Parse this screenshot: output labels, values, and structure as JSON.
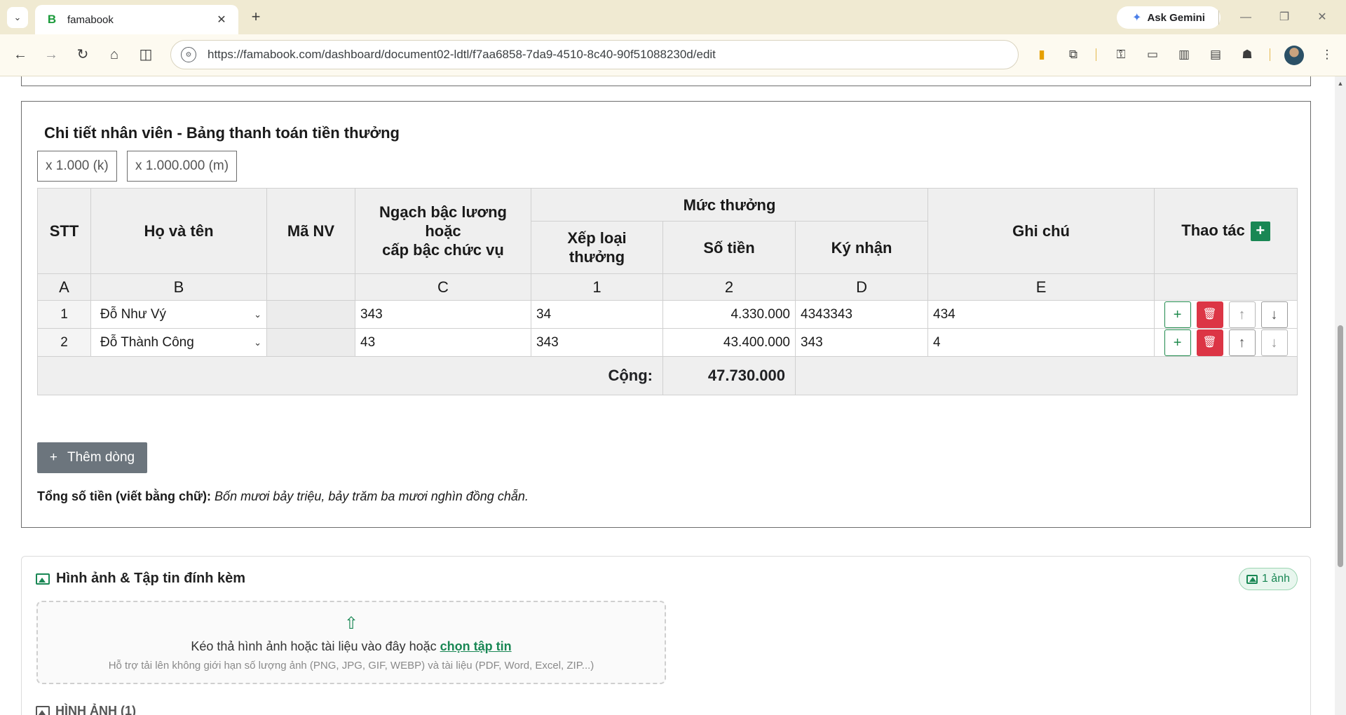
{
  "browser": {
    "tab_title": "famabook",
    "tab_favicon": "B",
    "url": "https://famabook.com/dashboard/document02-ldtl/f7aa6858-7da9-4510-8c40-90f51088230d/edit",
    "gemini_label": "Ask Gemini"
  },
  "panel": {
    "title": "Chi tiết nhân viên - Bảng thanh toán tiền thưởng",
    "unit_k": "x 1.000 (k)",
    "unit_m": "x 1.000.000 (m)"
  },
  "table": {
    "headers": {
      "stt": "STT",
      "name": "Họ và tên",
      "code": "Mã NV",
      "grade_1": "Ngạch bậc lương",
      "grade_2": "hoặc",
      "grade_3": "cấp bậc chức vụ",
      "bonus_group": "Mức thưởng",
      "rank_1": "Xếp loại",
      "rank_2": "thưởng",
      "amount": "Số tiền",
      "sign": "Ký nhận",
      "note": "Ghi chú",
      "actions": "Thao tác"
    },
    "letters": [
      "A",
      "B",
      "",
      "C",
      "1",
      "2",
      "D",
      "E",
      ""
    ],
    "rows": [
      {
        "stt": "1",
        "name": "Đỗ Như Vý",
        "code": "",
        "grade": "343",
        "rank": "34",
        "amount": "4.330.000",
        "sign": "4343343",
        "note": "434"
      },
      {
        "stt": "2",
        "name": "Đỗ Thành Công",
        "code": "",
        "grade": "43",
        "rank": "343",
        "amount": "43.400.000",
        "sign": "343",
        "note": "4"
      }
    ],
    "total_label": "Cộng:",
    "total_value": "47.730.000"
  },
  "add_row_label": "Thêm dòng",
  "words": {
    "label": "Tổng số tiền (viết bằng chữ):",
    "value": "Bốn mươi bảy triệu, bảy trăm ba mươi nghìn đồng chẵn."
  },
  "attachments": {
    "title": "Hình ảnh & Tập tin đính kèm",
    "badge": "1 ảnh",
    "drop_text": "Kéo thả hình ảnh hoặc tài liệu vào đây hoặc",
    "drop_link": "chọn tập tin",
    "drop_sub": "Hỗ trợ tải lên không giới hạn số lượng ảnh (PNG, JPG, GIF, WEBP) và tài liệu (PDF, Word, Excel, ZIP...)",
    "images_heading": "HÌNH ẢNH (1)"
  },
  "colors": {
    "accent_green": "#198754",
    "danger_red": "#dc3545",
    "secondary_grey": "#6c757d"
  }
}
